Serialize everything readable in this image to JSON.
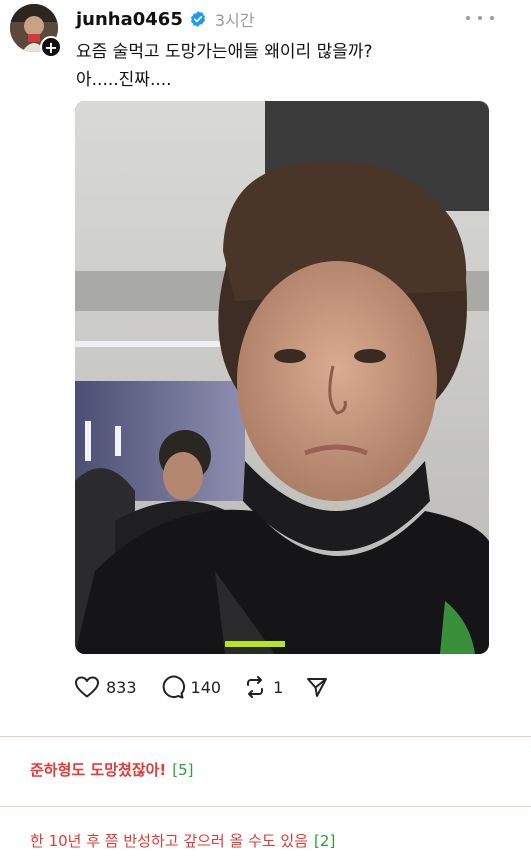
{
  "post": {
    "username": "junha0465",
    "time": "3시간",
    "caption": [
      "요즘 술먹고 도망가는애들 왜이리 많을까?",
      "아.....진짜...."
    ],
    "stats": {
      "likes": "833",
      "replies": "140",
      "reposts": "1"
    },
    "icons": {
      "avatar": "avatar",
      "verified": "verified-badge-icon",
      "follow": "plus-icon",
      "more": "more-options-icon",
      "like": "heart-icon",
      "reply": "comment-bubble-icon",
      "repost": "repost-icon",
      "share": "share-send-icon"
    },
    "colors": {
      "verified": "#1d9bf0",
      "text": "#111111",
      "muted": "#9a9a9a"
    }
  },
  "comments": [
    {
      "text": "준하형도 도망쳤잖아!",
      "count": "[5]"
    },
    {
      "text": "한 10년 후 쯤 반성하고 갚으러 올 수도 있음",
      "count": "[2]"
    }
  ],
  "comment_colors": {
    "text": "#e53935",
    "count": "#2e9e3f",
    "divider": "#f1c9c9"
  }
}
